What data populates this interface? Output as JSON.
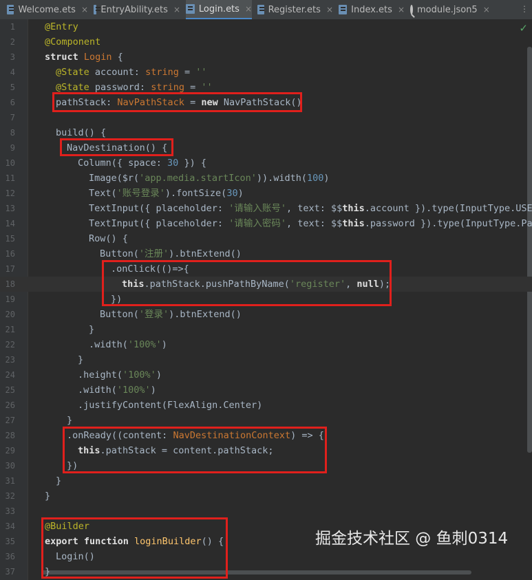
{
  "tabs": [
    {
      "label": "Welcome.ets",
      "icon": "ets-file-icon",
      "active": false
    },
    {
      "label": "EntryAbility.ets",
      "icon": "ets-file-icon",
      "active": false
    },
    {
      "label": "Login.ets",
      "icon": "ets-file-icon",
      "active": true
    },
    {
      "label": "Register.ets",
      "icon": "ets-file-icon",
      "active": false
    },
    {
      "label": "Index.ets",
      "icon": "ets-file-icon",
      "active": false
    },
    {
      "label": "module.json5",
      "icon": "json-file-icon",
      "active": false
    }
  ],
  "tab_close_glyph": "×",
  "tab_overflow_glyph": "⋮",
  "inspection_status": "✓",
  "current_line": 18,
  "watermark": "掘金技术社区 @ 鱼刺0314",
  "lines": [
    {
      "n": "1",
      "indent": 0,
      "tokens": [
        [
          "ann",
          "@Entry"
        ]
      ]
    },
    {
      "n": "2",
      "indent": 0,
      "tokens": [
        [
          "ann",
          "@Component"
        ]
      ]
    },
    {
      "n": "3",
      "indent": 0,
      "tokens": [
        [
          "kwb",
          "struct "
        ],
        [
          "dim",
          "Login"
        ],
        [
          "plain",
          " {"
        ]
      ]
    },
    {
      "n": "4",
      "indent": 1,
      "tokens": [
        [
          "ann",
          "@State "
        ],
        [
          "plain",
          "account: "
        ],
        [
          "ty",
          "string"
        ],
        [
          "plain",
          " = "
        ],
        [
          "str",
          "''"
        ]
      ]
    },
    {
      "n": "5",
      "indent": 1,
      "tokens": [
        [
          "ann",
          "@State "
        ],
        [
          "plain",
          "password: "
        ],
        [
          "ty",
          "string"
        ],
        [
          "plain",
          " = "
        ],
        [
          "str",
          "''"
        ]
      ]
    },
    {
      "n": "6",
      "indent": 1,
      "tokens": [
        [
          "plain",
          "pathStack: "
        ],
        [
          "ty",
          "NavPathStack"
        ],
        [
          "plain",
          " = "
        ],
        [
          "kwb",
          "new "
        ],
        [
          "plain",
          "NavPathStack()"
        ]
      ]
    },
    {
      "n": "7",
      "indent": 0,
      "tokens": []
    },
    {
      "n": "8",
      "indent": 1,
      "tokens": [
        [
          "plain",
          "build() {"
        ]
      ]
    },
    {
      "n": "9",
      "indent": 2,
      "tokens": [
        [
          "plain",
          "NavDestination() {"
        ]
      ]
    },
    {
      "n": "10",
      "indent": 3,
      "tokens": [
        [
          "plain",
          "Column({ space: "
        ],
        [
          "num",
          "30"
        ],
        [
          "plain",
          " }) {"
        ]
      ]
    },
    {
      "n": "11",
      "indent": 4,
      "tokens": [
        [
          "plain",
          "Image($r("
        ],
        [
          "str",
          "'app.media.startIcon'"
        ],
        [
          "plain",
          ")).width("
        ],
        [
          "num",
          "100"
        ],
        [
          "plain",
          ")"
        ]
      ]
    },
    {
      "n": "12",
      "indent": 4,
      "tokens": [
        [
          "plain",
          "Text("
        ],
        [
          "str",
          "'账号登录'"
        ],
        [
          "plain",
          ").fontSize("
        ],
        [
          "num",
          "30"
        ],
        [
          "plain",
          ")"
        ]
      ]
    },
    {
      "n": "13",
      "indent": 4,
      "tokens": [
        [
          "plain",
          "TextInput({ placeholder: "
        ],
        [
          "str",
          "'请输入账号'"
        ],
        [
          "plain",
          ", text: $$"
        ],
        [
          "kwb",
          "this"
        ],
        [
          "plain",
          ".account }).type(InputType.USER_"
        ]
      ]
    },
    {
      "n": "14",
      "indent": 4,
      "tokens": [
        [
          "plain",
          "TextInput({ placeholder: "
        ],
        [
          "str",
          "'请输入密码'"
        ],
        [
          "plain",
          ", text: $$"
        ],
        [
          "kwb",
          "this"
        ],
        [
          "plain",
          ".password }).type(InputType.Pass"
        ]
      ]
    },
    {
      "n": "15",
      "indent": 4,
      "tokens": [
        [
          "plain",
          "Row() {"
        ]
      ]
    },
    {
      "n": "16",
      "indent": 5,
      "tokens": [
        [
          "plain",
          "Button("
        ],
        [
          "str",
          "'注册'"
        ],
        [
          "plain",
          ").btnExtend()"
        ]
      ]
    },
    {
      "n": "17",
      "indent": 6,
      "tokens": [
        [
          "plain",
          ".onClick(()=>{"
        ]
      ]
    },
    {
      "n": "18",
      "indent": 7,
      "tokens": [
        [
          "kwb",
          "this"
        ],
        [
          "plain",
          ".pathStack.pushPathByName("
        ],
        [
          "str",
          "'register'"
        ],
        [
          "plain",
          ", "
        ],
        [
          "kwb",
          "null"
        ],
        [
          "plain",
          ");"
        ]
      ]
    },
    {
      "n": "19",
      "indent": 6,
      "tokens": [
        [
          "plain",
          "})"
        ]
      ]
    },
    {
      "n": "20",
      "indent": 5,
      "tokens": [
        [
          "plain",
          "Button("
        ],
        [
          "str",
          "'登录'"
        ],
        [
          "plain",
          ").btnExtend()"
        ]
      ]
    },
    {
      "n": "21",
      "indent": 4,
      "tokens": [
        [
          "plain",
          "}"
        ]
      ]
    },
    {
      "n": "22",
      "indent": 4,
      "tokens": [
        [
          "plain",
          ".width("
        ],
        [
          "str",
          "'100%'"
        ],
        [
          "plain",
          ")"
        ]
      ]
    },
    {
      "n": "23",
      "indent": 3,
      "tokens": [
        [
          "plain",
          "}"
        ]
      ]
    },
    {
      "n": "24",
      "indent": 3,
      "tokens": [
        [
          "plain",
          ".height("
        ],
        [
          "str",
          "'100%'"
        ],
        [
          "plain",
          ")"
        ]
      ]
    },
    {
      "n": "25",
      "indent": 3,
      "tokens": [
        [
          "plain",
          ".width("
        ],
        [
          "str",
          "'100%'"
        ],
        [
          "plain",
          ")"
        ]
      ]
    },
    {
      "n": "26",
      "indent": 3,
      "tokens": [
        [
          "plain",
          ".justifyContent(FlexAlign.Center)"
        ]
      ]
    },
    {
      "n": "27",
      "indent": 2,
      "tokens": [
        [
          "plain",
          "}"
        ]
      ]
    },
    {
      "n": "28",
      "indent": 2,
      "tokens": [
        [
          "plain",
          ".onReady((content: "
        ],
        [
          "ty",
          "NavDestinationContext"
        ],
        [
          "plain",
          ") => {"
        ]
      ]
    },
    {
      "n": "29",
      "indent": 3,
      "tokens": [
        [
          "kwb",
          "this"
        ],
        [
          "plain",
          ".pathStack = content.pathStack;"
        ]
      ]
    },
    {
      "n": "30",
      "indent": 2,
      "tokens": [
        [
          "plain",
          "})"
        ]
      ]
    },
    {
      "n": "31",
      "indent": 1,
      "tokens": [
        [
          "plain",
          "}"
        ]
      ]
    },
    {
      "n": "32",
      "indent": 0,
      "tokens": [
        [
          "plain",
          "}"
        ]
      ]
    },
    {
      "n": "33",
      "indent": 0,
      "tokens": []
    },
    {
      "n": "34",
      "indent": 0,
      "tokens": [
        [
          "ann",
          "@Builder"
        ]
      ]
    },
    {
      "n": "35",
      "indent": 0,
      "tokens": [
        [
          "kwb",
          "export function "
        ],
        [
          "fn",
          "loginBuilder"
        ],
        [
          "plain",
          "() {"
        ]
      ]
    },
    {
      "n": "36",
      "indent": 1,
      "tokens": [
        [
          "plain",
          "Login()"
        ]
      ]
    },
    {
      "n": "37",
      "indent": 0,
      "tokens": [
        [
          "plain",
          "}"
        ]
      ]
    }
  ]
}
